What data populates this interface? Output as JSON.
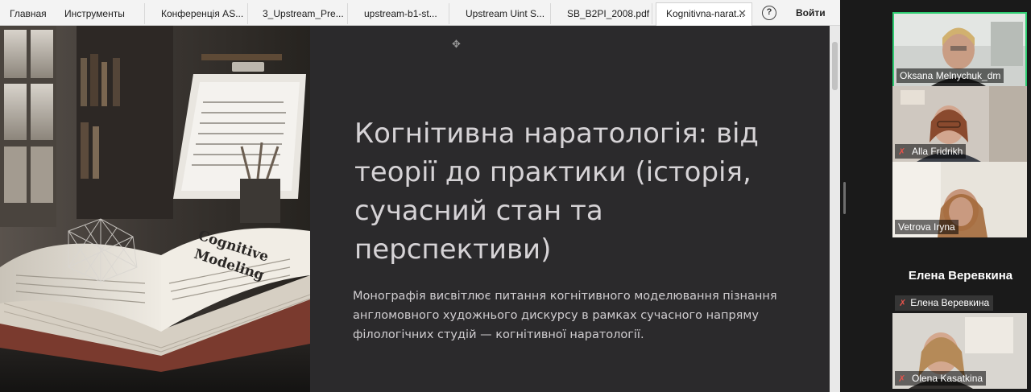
{
  "tabs": [
    {
      "label": "Главная",
      "active": false
    },
    {
      "label": "Инструменты",
      "active": false
    },
    {
      "label": "Конференція AS...",
      "active": false
    },
    {
      "label": "3_Upstream_Pre...",
      "active": false
    },
    {
      "label": "upstream-b1-st...",
      "active": false
    },
    {
      "label": "Upstream Uint S...",
      "active": false
    },
    {
      "label": "SB_B2PI_2008.pdf",
      "active": false
    },
    {
      "label": "Kognitivna-narat...",
      "active": true
    }
  ],
  "toolbar": {
    "close_glyph": "✕",
    "help_glyph": "?",
    "login_label": "Войти"
  },
  "slide": {
    "title": "Когнітивна наратологія: від теорії до практики (історія, сучасний стан та перспективи)",
    "description": "Монографія висвітлює питання когнітивного моделювання пізнання англомовного художнього дискурсу в рамках сучасного напряму філологічних студій — когнітивної наратології.",
    "book_cover_lines": [
      "Cognitive",
      "Modeling"
    ],
    "cursor_glyph": "✥"
  },
  "participants": {
    "tiles": [
      {
        "name": "Oksana Melnychuk_dm",
        "muted": false,
        "active_speaker": true
      },
      {
        "name": "Alla Fridrikh",
        "muted": true,
        "active_speaker": false
      },
      {
        "name": "Vetrova Iryna",
        "muted": false,
        "active_speaker": false
      },
      {
        "name": "Olena Kasatkina",
        "muted": true,
        "active_speaker": false
      }
    ],
    "no_video": {
      "display_name": "Елена Веревкина",
      "label": "Елена Веревкина",
      "muted": true
    },
    "mute_icon": "mic-off-icon"
  },
  "colors": {
    "active_speaker_border": "#2ecc71",
    "muted_icon": "#e5534b",
    "slide_bg": "#2b2a2c",
    "slide_text": "#d6d3d6"
  }
}
